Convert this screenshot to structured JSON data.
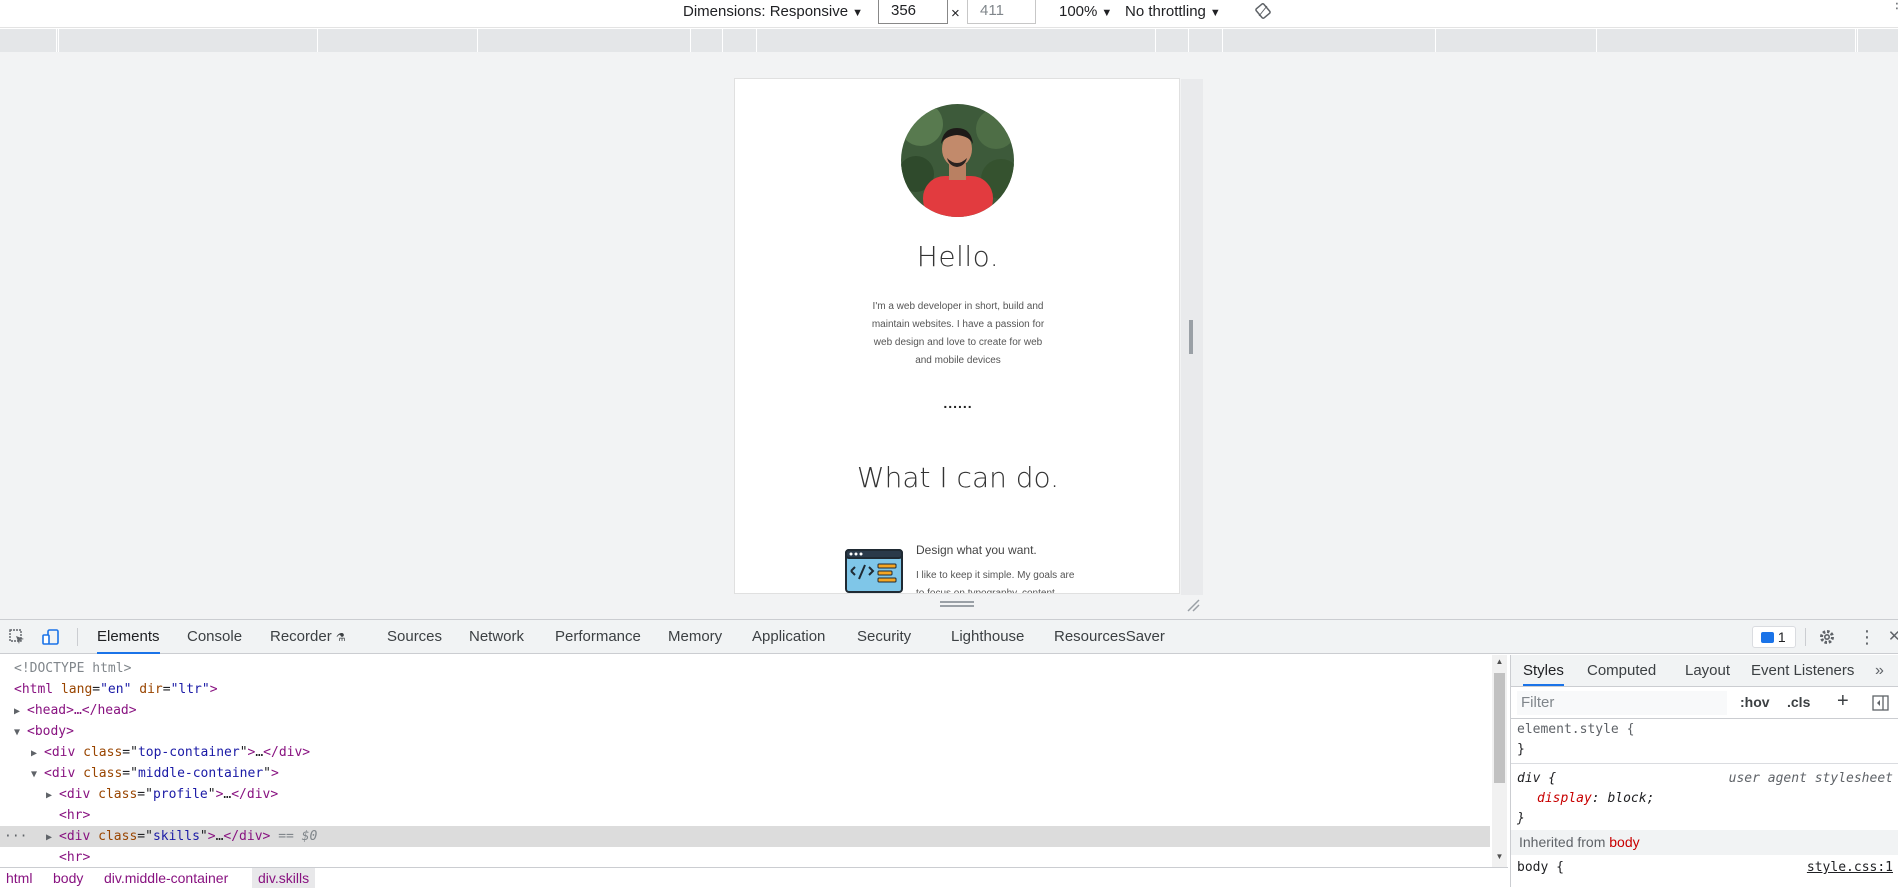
{
  "device_toolbar": {
    "dimensions_label": "Dimensions: Responsive",
    "width_value": "356",
    "height_value": "411",
    "times": "×",
    "zoom": "100%",
    "throttling": "No throttling"
  },
  "page": {
    "heading": "Hello.",
    "intro": "I'm a web developer in short, build and maintain websites. I have a passion for web design and love to create for web and mobile devices",
    "divider": "......",
    "section_title": "What I can do.",
    "skill_title": "Design what you want.",
    "skill_desc": "I like to keep it simple. My goals are to focus on typography, content"
  },
  "devtools": {
    "tabs": [
      {
        "label": "Elements"
      },
      {
        "label": "Console"
      },
      {
        "label": "Recorder"
      },
      {
        "label": "Sources"
      },
      {
        "label": "Network"
      },
      {
        "label": "Performance"
      },
      {
        "label": "Memory"
      },
      {
        "label": "Application"
      },
      {
        "label": "Security"
      },
      {
        "label": "Lighthouse"
      },
      {
        "label": "ResourcesSaver"
      }
    ],
    "message_count": "1",
    "dom": {
      "doctype": "<!DOCTYPE html>",
      "html_tag": "html",
      "html_attr1_name": "lang",
      "html_attr1_value": "\"en\"",
      "html_attr2_name": "dir",
      "html_attr2_value": "\"ltr\"",
      "head": "<head>…</head>",
      "body_open": "<body>",
      "top_container": "top-container",
      "middle_container": "middle-container",
      "profile": "profile",
      "hr": "<hr>",
      "skills": "skills",
      "selected_marker": "== $0",
      "ellipsis": "…"
    },
    "breadcrumbs": [
      "html",
      "body",
      "div.middle-container",
      "div.skills"
    ]
  },
  "styles_panel": {
    "tabs": [
      "Styles",
      "Computed",
      "Layout",
      "Event Listeners"
    ],
    "filter_placeholder": "Filter",
    "hov": ":hov",
    "cls": ".cls",
    "element_style": "element.style {",
    "close_brace": "}",
    "div_selector": "div {",
    "ua_label": "user agent stylesheet",
    "prop_name": "display",
    "prop_value": "block;",
    "inherited_prefix": "Inherited from",
    "inherited_from": "body",
    "body_selector": "body {",
    "source_link": "style.css:1"
  },
  "colors": {
    "accent": "#1a73e8",
    "tag": "#881280",
    "attr_name": "#994500",
    "attr_value": "#1a1aa6"
  }
}
